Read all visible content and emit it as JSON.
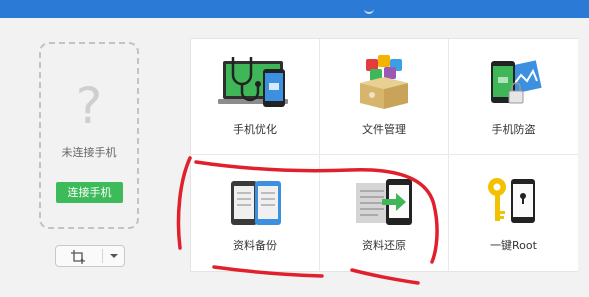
{
  "colors": {
    "topbar": "#2b7bd6",
    "connect_button": "#3dbb5b",
    "annotation": "#e0212d"
  },
  "left_panel": {
    "placeholder_icon": "question-mark-icon",
    "status_text": "未连接手机",
    "connect_button": "连接手机",
    "screenshot_icon": "screenshot-crop-icon"
  },
  "tools": [
    {
      "label": "手机优化",
      "icon": "stethoscope-phone-icon"
    },
    {
      "label": "文件管理",
      "icon": "file-box-icon"
    },
    {
      "label": "手机防盗",
      "icon": "phone-lock-icon"
    },
    {
      "label": "资料备份",
      "icon": "backup-phones-icon"
    },
    {
      "label": "资料还原",
      "icon": "restore-document-icon"
    },
    {
      "label": "一键Root",
      "icon": "key-phone-icon"
    }
  ],
  "annotation": "red-hand-drawn-circle"
}
